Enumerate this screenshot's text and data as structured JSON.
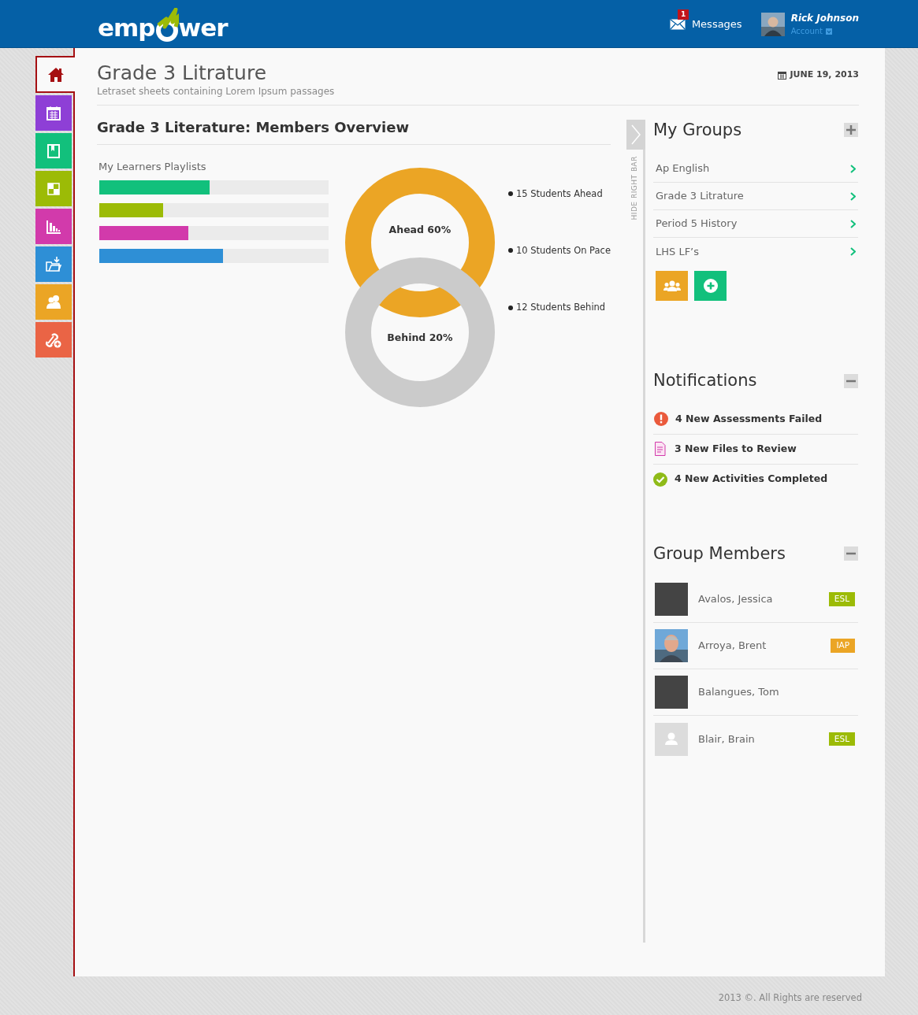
{
  "header": {
    "logo": {
      "before": "emp",
      "after": "wer"
    },
    "messages": {
      "label": "Messages",
      "count": "1"
    },
    "user": {
      "name": "Rick Johnson",
      "account": "Account"
    }
  },
  "nav": [
    {
      "selected": true,
      "color": "#a50f12"
    },
    {
      "selected": false,
      "color": "#8e3fd6"
    },
    {
      "selected": false,
      "color": "#12c07c"
    },
    {
      "selected": false,
      "color": "#9cbb06"
    },
    {
      "selected": false,
      "color": "#d23aab"
    },
    {
      "selected": false,
      "color": "#2e8fd6"
    },
    {
      "selected": false,
      "color": "#eba525"
    },
    {
      "selected": false,
      "color": "#ea6445"
    }
  ],
  "page": {
    "title": "Grade 3 Litrature",
    "subtitle": "Letraset sheets containing Lorem Ipsum passages",
    "date": "JUNE 19, 2013"
  },
  "overview": {
    "title": "Grade 3 Literature: Members Overview",
    "playlists_label": "My Learners Playlists",
    "playlists": [
      {
        "level": 0.48,
        "color": "#12c07c"
      },
      {
        "level": 0.28,
        "color": "#9cbb06"
      },
      {
        "level": 0.39,
        "color": "#d23aab"
      },
      {
        "level": 0.54,
        "color": "#2e8fd6"
      }
    ],
    "rings": [
      {
        "label": "Ahead 60%",
        "color": "#eba525"
      },
      {
        "label": "Behind 20%",
        "color": "#cbcbcb"
      }
    ],
    "legend": [
      "15 Students Ahead",
      "10 Students On Pace",
      "12 Students Behind"
    ]
  },
  "hide_bar": {
    "label": "HIDE RIGHT BAR"
  },
  "my_groups": {
    "title": "My Groups",
    "items": [
      "Ap English",
      "Grade 3 Litrature",
      "Period 5 History",
      "LHS LF’s"
    ]
  },
  "notifications": {
    "title": "Notifications",
    "expanded": true,
    "items": [
      {
        "kind": "alert",
        "text": "4 New Assessments Failed"
      },
      {
        "kind": "file",
        "text": "3 New Files to Review"
      },
      {
        "kind": "done",
        "text": "4 New Activities Completed"
      }
    ]
  },
  "group_members": {
    "title": "Group Members",
    "expanded": true,
    "items": [
      {
        "name": "Avalos, Jessica",
        "kind": "dark",
        "tag": "ESL",
        "color": "#9cbb06"
      },
      {
        "name": "Arroya, Brent",
        "tag": "IAP",
        "color": "#eba525"
      },
      {
        "name": "Balangues, Tom",
        "kind": "dark"
      },
      {
        "name": "Blair, Brain",
        "kind": "placeholder",
        "tag": "ESL",
        "color": "#9cbb06"
      }
    ]
  },
  "footer": "2013 ©. All Rights are reserved"
}
